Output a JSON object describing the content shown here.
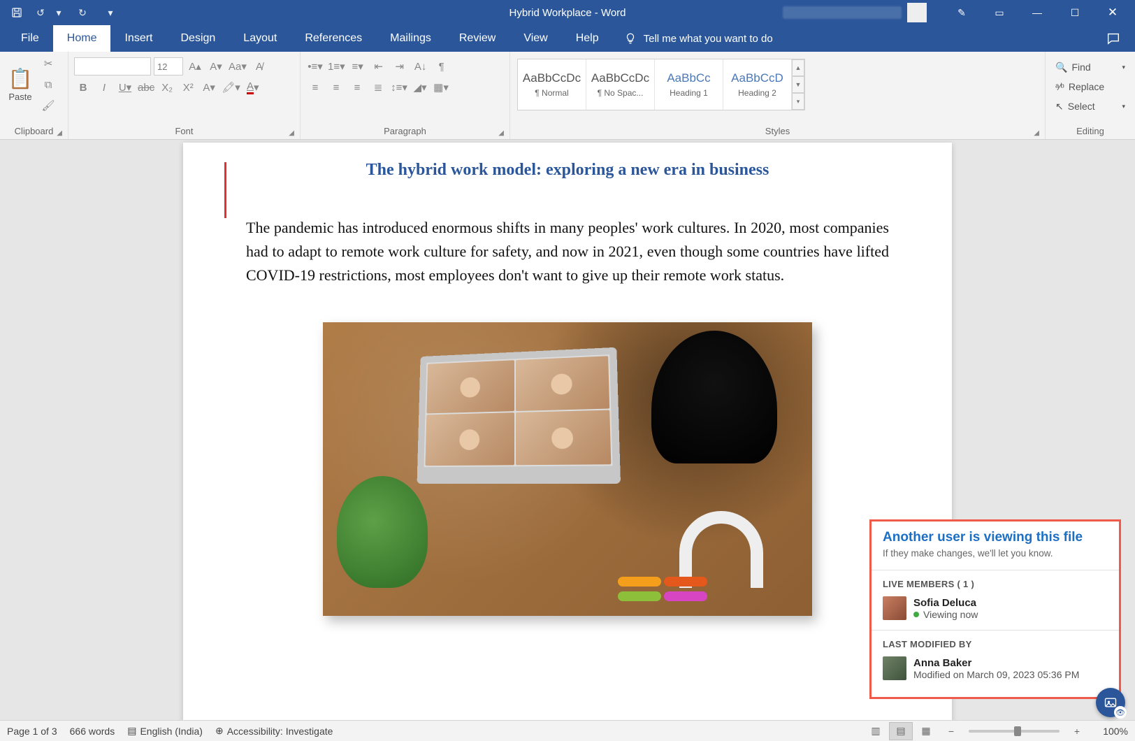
{
  "titlebar": {
    "doc_name": "Hybrid Workplace",
    "app_name": "Word",
    "separator": "  -  "
  },
  "tabs": {
    "file": "File",
    "home": "Home",
    "insert": "Insert",
    "design": "Design",
    "layout": "Layout",
    "references": "References",
    "mailings": "Mailings",
    "review": "Review",
    "view": "View",
    "help": "Help",
    "tellme": "Tell me what you want to do"
  },
  "ribbon": {
    "clipboard": {
      "paste": "Paste",
      "label": "Clipboard"
    },
    "font": {
      "size": "12",
      "label": "Font"
    },
    "paragraph": {
      "label": "Paragraph"
    },
    "styles": {
      "label": "Styles",
      "items": [
        {
          "preview": "AaBbCcDc",
          "name": "¶ Normal"
        },
        {
          "preview": "AaBbCcDc",
          "name": "¶ No Spac..."
        },
        {
          "preview": "AaBbCc",
          "name": "Heading 1"
        },
        {
          "preview": "AaBbCcD",
          "name": "Heading 2"
        }
      ]
    },
    "editing": {
      "find": "Find",
      "replace": "Replace",
      "select": "Select",
      "label": "Editing"
    }
  },
  "document": {
    "title": "The hybrid work model: exploring a new era in business",
    "para1": "The pandemic has introduced enormous shifts in many peoples' work cultures. In 2020, most companies had to adapt to remote work culture for safety, and now in 2021, even though some countries have lifted COVID-19 restrictions, most employees don't want to give up their remote work status."
  },
  "notification": {
    "heading": "Another user is viewing this file",
    "sub": "If they make changes, we'll let you know.",
    "live_label": "LIVE MEMBERS ( 1 )",
    "live_member": {
      "name": "Sofia Deluca",
      "status": "Viewing now"
    },
    "mod_label": "LAST MODIFIED BY",
    "mod_member": {
      "name": "Anna Baker",
      "status": "Modified on March 09, 2023 05:36 PM"
    }
  },
  "statusbar": {
    "page": "Page 1 of 3",
    "words": "666 words",
    "lang": "English (India)",
    "access": "Accessibility: Investigate",
    "zoom": "100%"
  }
}
